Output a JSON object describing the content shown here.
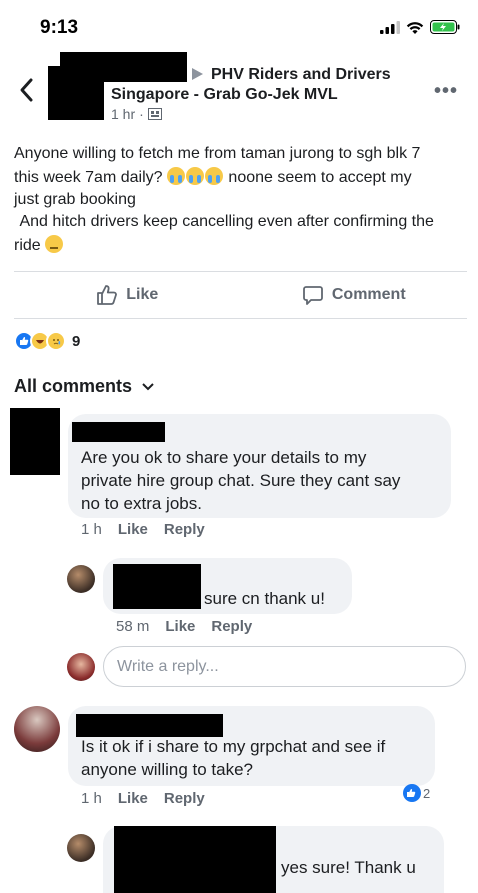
{
  "status": {
    "time": "9:13"
  },
  "post": {
    "group_line1": "PHV Riders and Drivers",
    "group_line2": "Singapore - Grab Go-Jek MVL",
    "time": "1 hr",
    "text_line1": "Anyone willing to fetch me from taman jurong to sgh blk 7",
    "text_line2a": "this week 7am daily?",
    "text_line2b": "noone seem to accept my",
    "text_line3": "just grab booking",
    "text_line4": "And hitch drivers keep cancelling even after confirming the",
    "text_line5": "ride",
    "like_label": "Like",
    "comment_label": "Comment",
    "reaction_count": "9"
  },
  "comments_header": "All comments",
  "comments": [
    {
      "text_l1": "Are you ok to share your details to my",
      "text_l2": "private hire group chat. Sure they cant say",
      "text_l3": "no to extra jobs.",
      "time": "1 h",
      "like": "Like",
      "reply": "Reply"
    },
    {
      "text": "sure cn thank u!",
      "time": "58 m",
      "like": "Like",
      "reply": "Reply"
    },
    {
      "text_l1": "Is it ok if i share to my grpchat and see if",
      "text_l2": "anyone willing to take?",
      "time": "1 h",
      "like": "Like",
      "reply": "Reply",
      "like_count": "2"
    },
    {
      "text": "yes sure! Thank u"
    }
  ],
  "reply_placeholder": "Write a reply...",
  "colors": {
    "like_blue": "#1877f2",
    "text": "#1c1e21",
    "muted": "#606770",
    "bubble": "#f0f2f5"
  }
}
